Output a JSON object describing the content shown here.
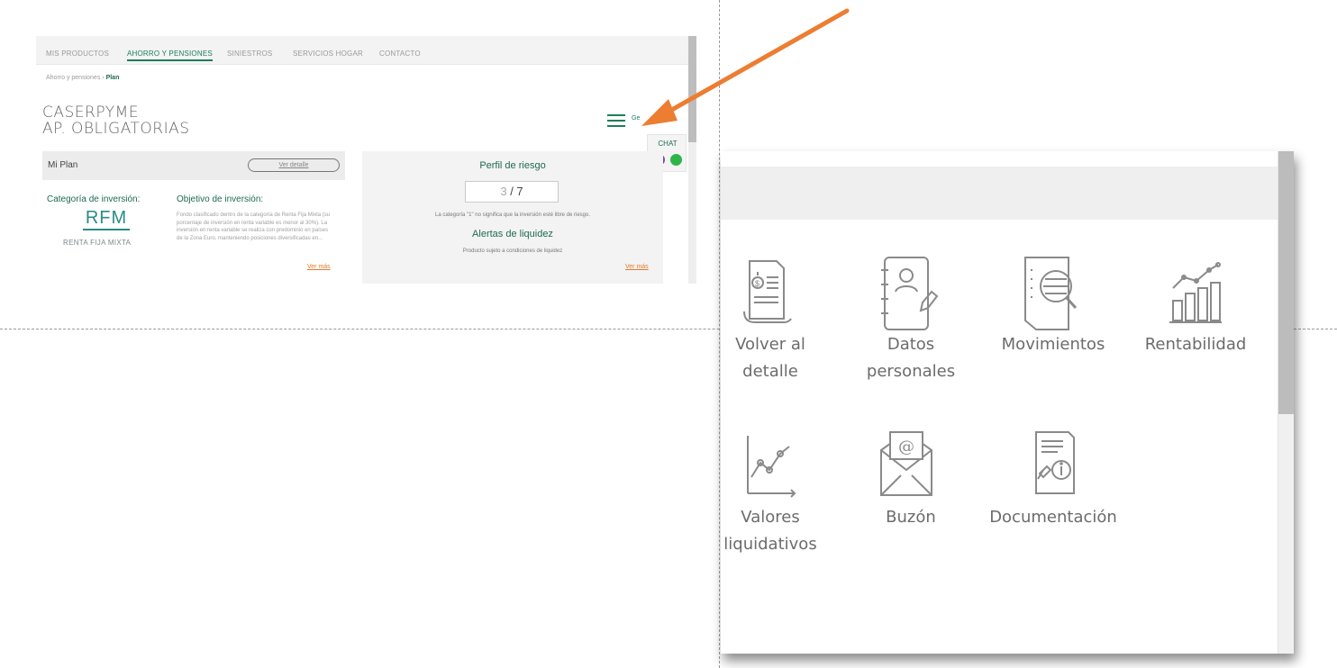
{
  "top_nav": {
    "items": [
      "MIS PRODUCTOS",
      "AHORRO Y PENSIONES",
      "SINIESTROS",
      "SERVICIOS HOGAR",
      "CONTACTO"
    ],
    "active": "AHORRO Y PENSIONES"
  },
  "breadcrumb": {
    "parent": "Ahorro y pensiones",
    "separator": " › ",
    "current": "Plan"
  },
  "plan_title": {
    "line1": "CASERPYME",
    "line2": "AP. OBLIGATORIAS"
  },
  "menu": {
    "tag": "Ge"
  },
  "chat": {
    "label": "CHAT"
  },
  "mi_plan": {
    "title": "Mi Plan",
    "detail_link": "Ver detalle",
    "category_label": "Categoría de inversión:",
    "category_code": "RFM",
    "category_name": "RENTA FIJA MIXTA",
    "objective_label": "Objetivo de inversión:",
    "objective_text": "Fondo clasificado dentro de la categoría de Renta Fija Mixta (su porcentaje de inversión en renta variable es menor al 30%). La inversión en renta variable se realiza con predominio en países de la Zona Euro, manteniendo posiciones diversificadas en...",
    "objective_more": "Ver más"
  },
  "risk": {
    "title": "Perfil de riesgo",
    "value": "3",
    "separator": " / ",
    "max": "7",
    "note": "La categoría \"1\" no significa que la inversión esté libre de riesgo.",
    "liquidity_title": "Alertas de liquidez",
    "liquidity_text": "Producto sujeto a condiciones de liquidez",
    "liquidity_more": "Ver más"
  },
  "panel_menu": [
    {
      "label_line1": "Volver al",
      "label_line2": "detalle",
      "icon": "document-money-icon"
    },
    {
      "label_line1": "Datos",
      "label_line2": "personales",
      "icon": "address-book-icon"
    },
    {
      "label_line1": "Movimientos",
      "label_line2": "",
      "icon": "document-search-icon"
    },
    {
      "label_line1": "Rentabilidad",
      "label_line2": "",
      "icon": "bar-chart-trend-icon"
    },
    {
      "label_line1": "Valores",
      "label_line2": "liquidativos",
      "icon": "line-chart-icon"
    },
    {
      "label_line1": "Buzón",
      "label_line2": "",
      "icon": "mail-at-icon"
    },
    {
      "label_line1": "Documentación",
      "label_line2": "",
      "icon": "document-gavel-icon"
    }
  ],
  "colors": {
    "brand_green": "#1e7d5b",
    "accent_orange": "#e57a2b",
    "arrow_orange": "#ed7d31",
    "icon_gray": "#8a8a8a"
  }
}
